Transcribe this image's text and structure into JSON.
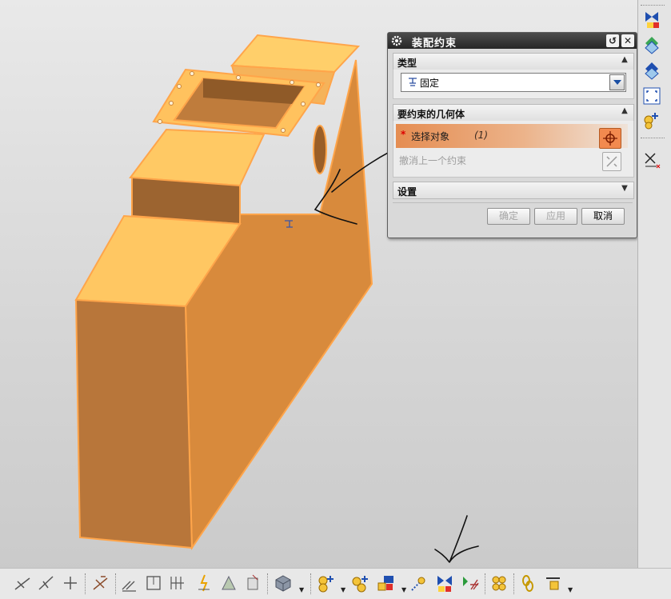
{
  "dialog": {
    "title": "装配约束",
    "type_section": {
      "header": "类型",
      "selected_value": "固定"
    },
    "geometry_section": {
      "header": "要约束的几何体",
      "select_label": "选择对象",
      "select_count": "(1)",
      "undo_label": "撤消上一个约束"
    },
    "settings_section": {
      "header": "设置"
    },
    "buttons": {
      "ok": "确定",
      "apply": "应用",
      "cancel": "取消"
    }
  },
  "colors": {
    "part_top": "#ffcf6a",
    "part_side": "#d88a3c",
    "part_front": "#b8763a",
    "part_edge": "#ffa54a",
    "selection_highlight": "#e58d52"
  },
  "icons": {
    "right_toolbar": [
      "touch-align-constraint-icon",
      "angle-constraint-icon",
      "parallel-constraint-icon",
      "fit-view-icon",
      "add-component-icon",
      "remove-constraint-icon"
    ],
    "bottom_toolbar": [
      "sketch-line-icon",
      "sketch-trim-icon",
      "sketch-extend-icon",
      "sketch-corner-icon",
      "section-icon",
      "datum-plane-icon",
      "measure-icon",
      "mirror-icon",
      "render-icon",
      "shaded-cube-icon",
      "add-component-icon",
      "new-component-icon",
      "create-array-icon",
      "move-component-icon",
      "assembly-constraints-icon",
      "reposition-icon",
      "explode-view-icon",
      "wave-linker-icon",
      "sequence-icon"
    ]
  }
}
